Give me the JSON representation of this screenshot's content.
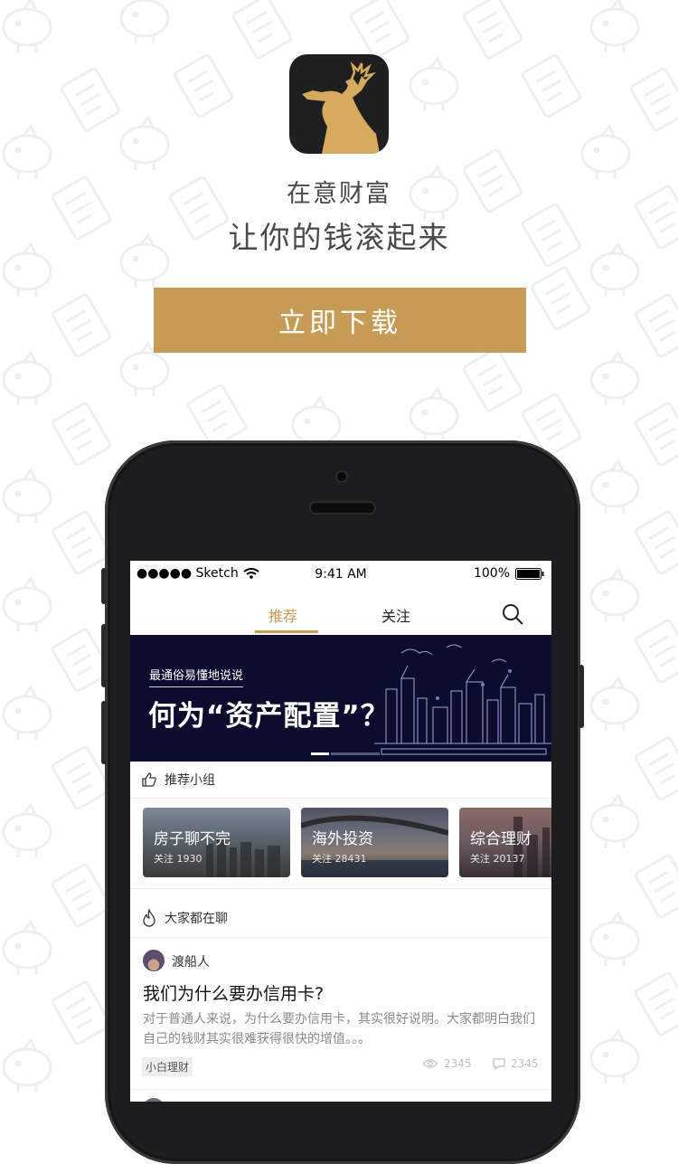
{
  "promo": {
    "tagline_1": "在意财富",
    "tagline_2": "让你的钱滚起来",
    "download_label": "立即下载"
  },
  "colors": {
    "accent": "#c69b56",
    "banner_bg": "#0c0d2e",
    "icon_bg": "#1f1f1f"
  },
  "status_bar": {
    "carrier": "●●●●● Sketch",
    "time": "9:41 AM",
    "battery": "100%"
  },
  "tabs": [
    {
      "label": "推荐",
      "active": true
    },
    {
      "label": "关注",
      "active": false
    }
  ],
  "banner": {
    "subtitle": "最通俗易懂地说说",
    "title": "何为“资产配置”？"
  },
  "groups_section": {
    "title": "推荐小组",
    "icon": "thumbs-up-icon",
    "groups": [
      {
        "name": "房子聊不完",
        "follow": "关注 1930"
      },
      {
        "name": "海外投资",
        "follow": "关注 28431"
      },
      {
        "name": "综合理财",
        "follow": "关注 20137"
      }
    ]
  },
  "chat_section": {
    "title": "大家都在聊",
    "icon": "flame-icon"
  },
  "post": {
    "author": "渡船人",
    "title": "我们为什么要办信用卡?",
    "excerpt": "对于普通人来说，为什么要办信用卡，其实很好说明。大家都明白我们自己的钱财其实很难获得很快的增值。。。",
    "tag": "小白理财",
    "views": "2345",
    "comments": "2345"
  }
}
